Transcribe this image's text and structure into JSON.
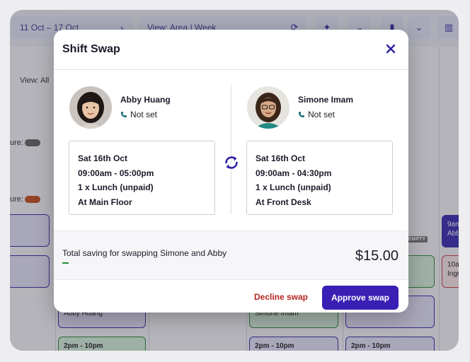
{
  "background": {
    "date_range": "11 Oct – 17 Oct",
    "view_select": "View: Area | Week",
    "filter_label": "View: All",
    "bg_label_1": "ure:",
    "bg_label_2": "ure:",
    "shift_9am": "9am",
    "shift_9am_name": "Abb",
    "shift_10am": "10ar",
    "shift_10am_name": "Ingr",
    "empty_badge": "EMPTY",
    "abby_huang_bg": "Abby Huang",
    "simone_imam_bg": "Simone Imam",
    "shift_2pm_a": "2pm - 10pm",
    "shift_2pm_b": "2pm - 10pm",
    "shift_2pm_c": "2pm - 10pm"
  },
  "modal": {
    "title": "Shift Swap",
    "left": {
      "name": "Abby Huang",
      "phone": "Not set",
      "shift": {
        "date": "Sat 16th Oct",
        "time": "09:00am - 05:00pm",
        "break": "1 x Lunch (unpaid)",
        "location": "At Main Floor"
      }
    },
    "right": {
      "name": "Simone Imam",
      "phone": "Not set",
      "shift": {
        "date": "Sat 16th Oct",
        "time": "09:00am - 04:30pm",
        "break": "1 x Lunch (unpaid)",
        "location": "At Front Desk"
      }
    },
    "saving_text": "Total saving for swapping Simone and Abby",
    "saving_amount": "$15.00",
    "decline_label": "Decline swap",
    "approve_label": "Approve swap"
  },
  "colors": {
    "accent": "#3a1fb4",
    "decline": "#b3261e",
    "saving_bar": "#1e8a3a"
  }
}
